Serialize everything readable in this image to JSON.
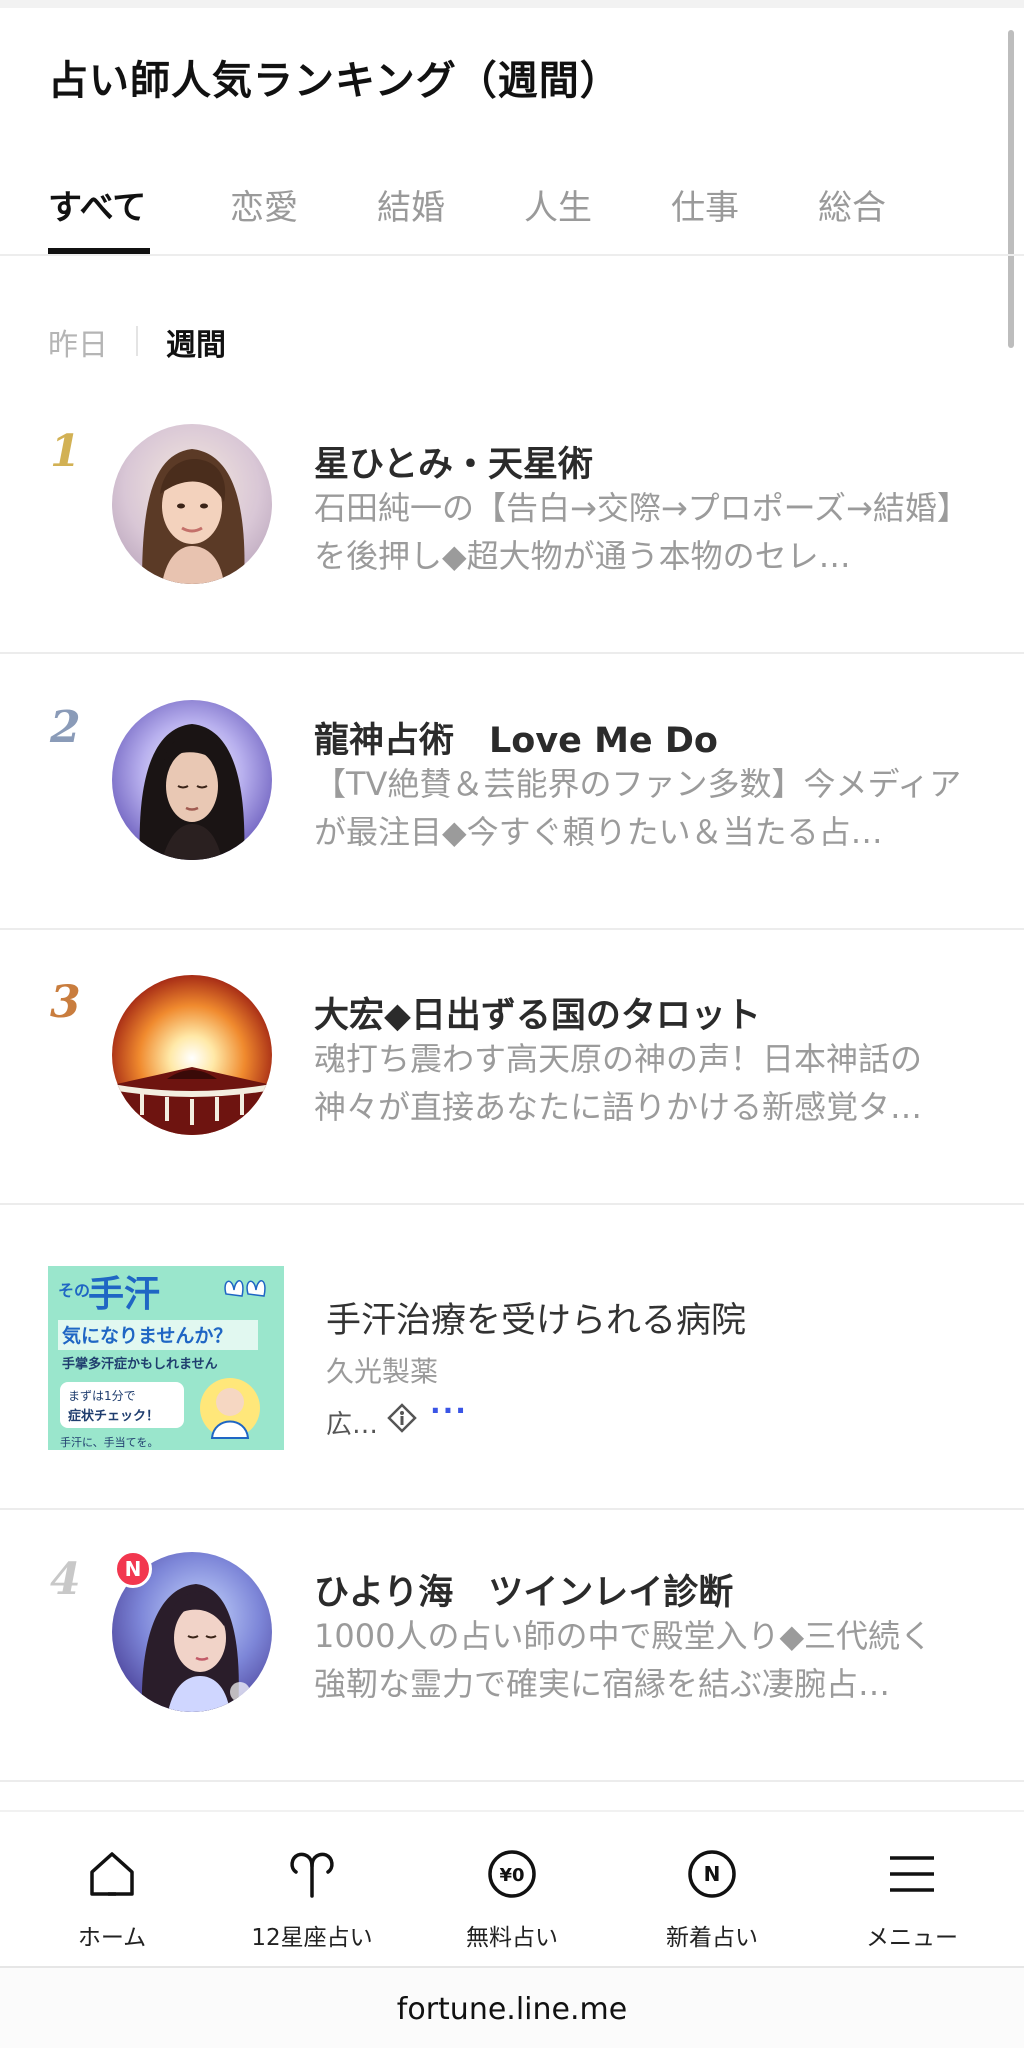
{
  "header": {
    "title": "占い師人気ランキング（週間）"
  },
  "tabs": [
    {
      "label": "すべて",
      "active": true
    },
    {
      "label": "恋愛",
      "active": false
    },
    {
      "label": "結婚",
      "active": false
    },
    {
      "label": "人生",
      "active": false
    },
    {
      "label": "仕事",
      "active": false
    },
    {
      "label": "総合",
      "active": false
    }
  ],
  "period": {
    "yesterday": "昨日",
    "weekly": "週間",
    "selected": "週間"
  },
  "rankings": [
    {
      "rank": "1",
      "rank_color": "#d2b154",
      "name": "星ひとみ・天星術",
      "description": "石田純一の【告白→交際→プロポーズ→結婚】を後押し◆超大物が通う本物のセレ…",
      "is_new": false
    },
    {
      "rank": "2",
      "rank_color": "#8a9bb8",
      "name": "龍神占術　Love Me Do",
      "description": "【TV絶賛＆芸能界のファン多数】今メディアが最注目◆今すぐ頼りたい＆当たる占…",
      "is_new": false
    },
    {
      "rank": "3",
      "rank_color": "#c97d3e",
      "name": "大宏◆日出ずる国のタロット",
      "description": "魂打ち震わす高天原の神の声！日本神話の神々が直接あなたに語りかける新感覚タ…",
      "is_new": false
    },
    {
      "rank": "4",
      "rank_color": "#c8c8c8",
      "name": "ひより海　ツインレイ診断",
      "description": "1000人の占い師の中で殿堂入り◆三代続く強靭な霊力で確実に宿縁を結ぶ凄腕占…",
      "is_new": true,
      "badge": "N"
    }
  ],
  "ad": {
    "headline": "手汗治療を受けられる病院",
    "sponsor": "久光製薬",
    "label": "広…",
    "more": "···",
    "image_text": {
      "top_small": "その",
      "top_big": "手汗",
      "line2": "気になりませんか？",
      "line3": "手掌多汗症かもしれません",
      "line4a": "まずは1分で",
      "line4b": "症状チェック！",
      "footer": "手汗に、手当てを。"
    }
  },
  "bottom_nav": [
    {
      "label": "ホーム",
      "icon": "home-icon"
    },
    {
      "label": "12星座占い",
      "icon": "aries-icon"
    },
    {
      "label": "無料占い",
      "icon": "free-yen-icon",
      "icon_text": "¥0"
    },
    {
      "label": "新着占い",
      "icon": "new-n-icon",
      "icon_text": "N"
    },
    {
      "label": "メニュー",
      "icon": "hamburger-menu-icon"
    }
  ],
  "browser": {
    "url": "fortune.line.me"
  }
}
